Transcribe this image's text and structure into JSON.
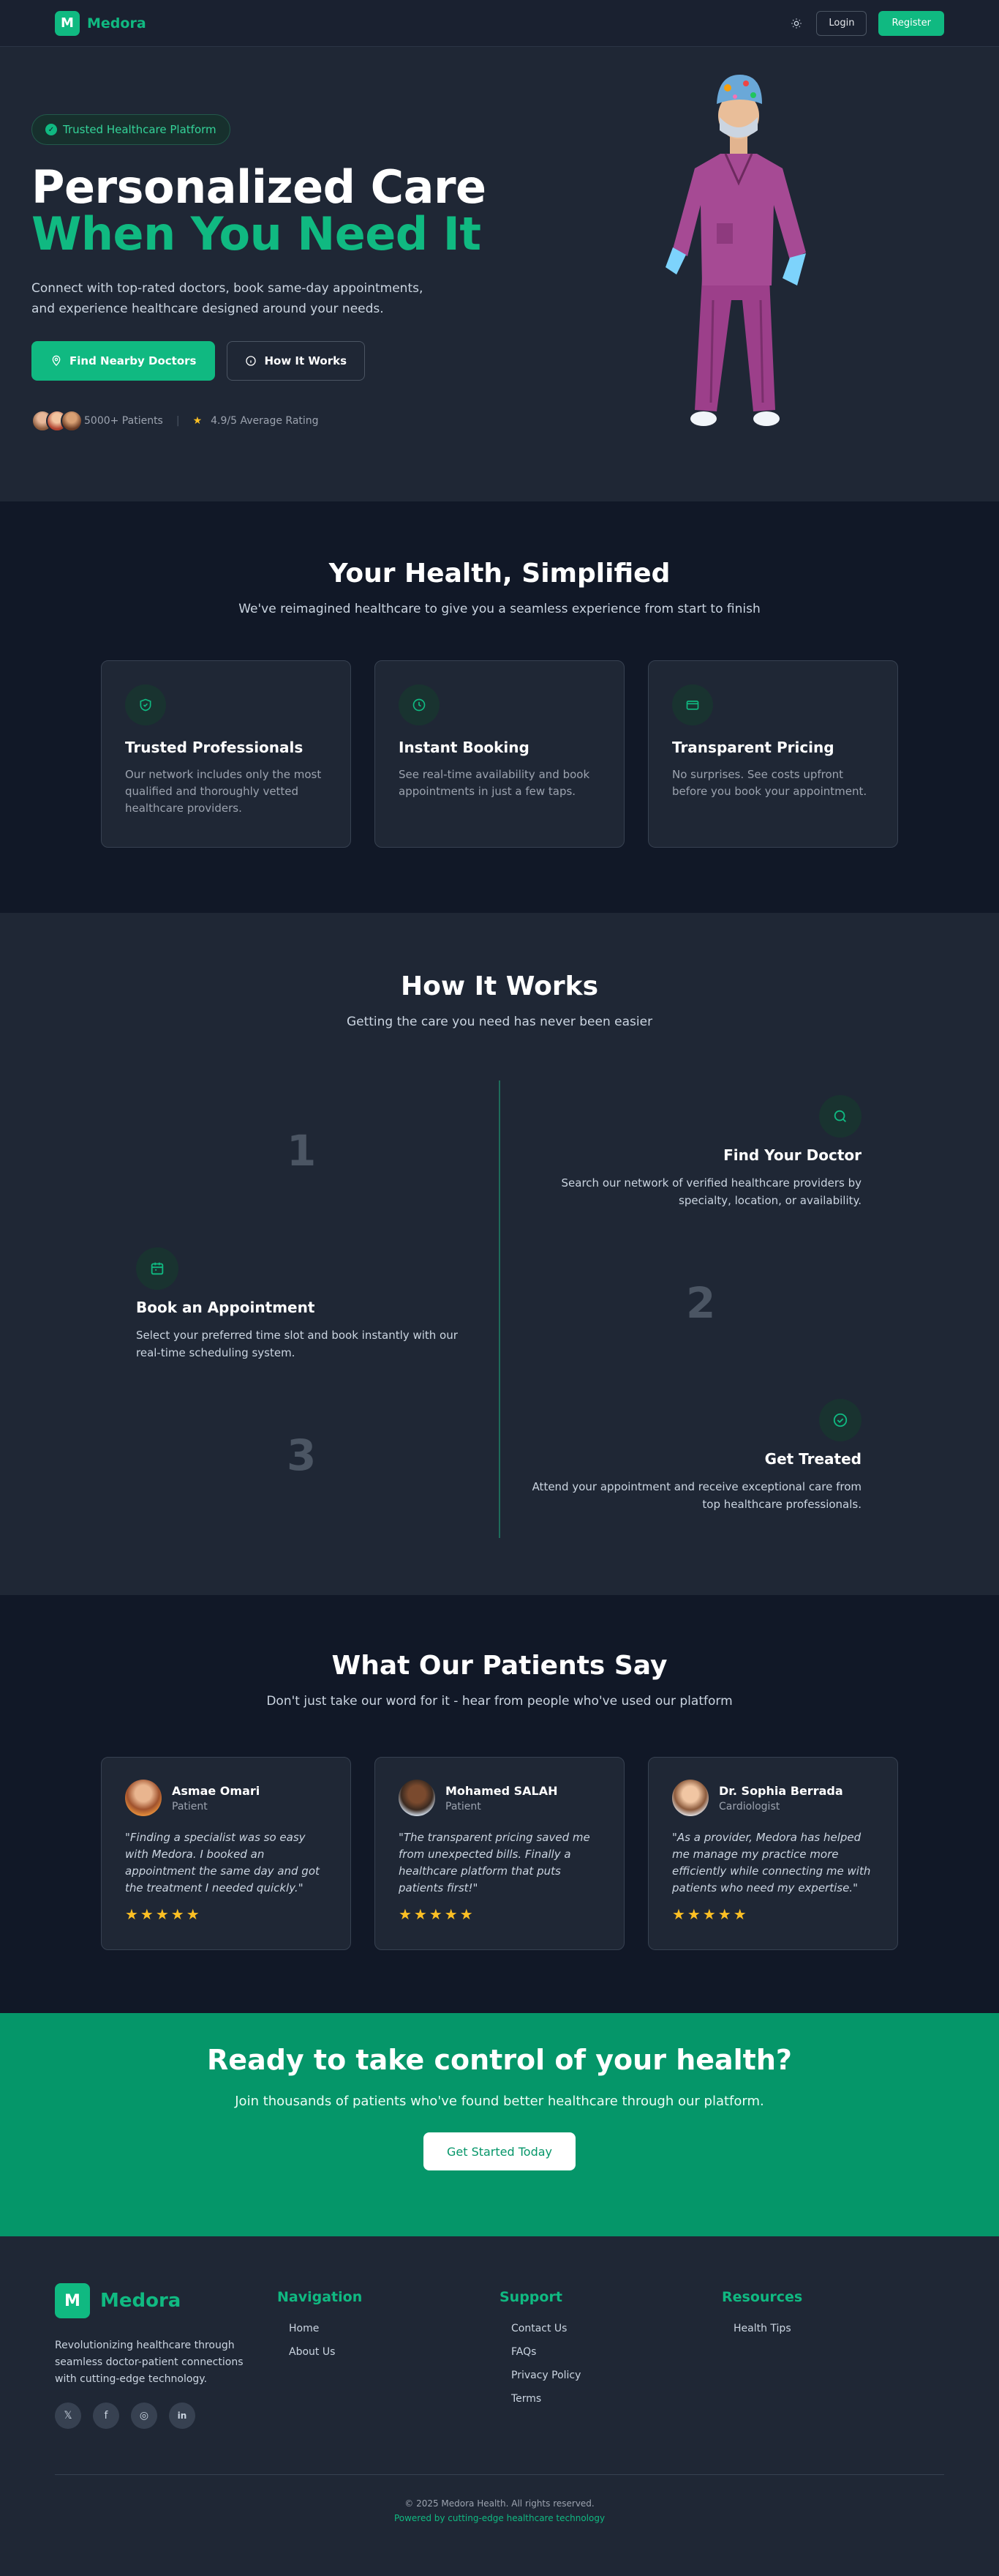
{
  "nav": {
    "logo_letter": "M",
    "brand": "Medora",
    "theme_icon": "sun-icon",
    "login": "Login",
    "register": "Register"
  },
  "hero": {
    "badge": "Trusted Healthcare Platform",
    "title_line1": "Personalized Care",
    "title_line2": "When You Need It",
    "subtitle": "Connect with top-rated doctors, book same-day appointments, and experience healthcare designed around your needs.",
    "primary_btn": "Find Nearby Doctors",
    "secondary_btn": "How It Works",
    "patients": "5000+ Patients",
    "rating": "4.9/5 Average Rating"
  },
  "features": {
    "title": "Your Health, Simplified",
    "subtitle": "We've reimagined healthcare to give you a seamless experience from start to finish",
    "cards": [
      {
        "icon": "shield-check-icon",
        "title": "Trusted Professionals",
        "text": "Our network includes only the most qualified and thoroughly vetted healthcare providers."
      },
      {
        "icon": "clock-icon",
        "title": "Instant Booking",
        "text": "See real-time availability and book appointments in just a few taps."
      },
      {
        "icon": "credit-card-icon",
        "title": "Transparent Pricing",
        "text": "No surprises. See costs upfront before you book your appointment."
      }
    ]
  },
  "how": {
    "title": "How It Works",
    "subtitle": "Getting the care you need has never been easier",
    "steps": [
      {
        "num": "1",
        "icon": "search-icon",
        "title": "Find Your Doctor",
        "text": "Search our network of verified healthcare providers by specialty, location, or availability."
      },
      {
        "num": "2",
        "icon": "calendar-icon",
        "title": "Book an Appointment",
        "text": "Select your preferred time slot and book instantly with our real-time scheduling system."
      },
      {
        "num": "3",
        "icon": "check-circle-icon",
        "title": "Get Treated",
        "text": "Attend your appointment and receive exceptional care from top healthcare professionals."
      }
    ]
  },
  "testimonials": {
    "title": "What Our Patients Say",
    "subtitle": "Don't just take our word for it - hear from people who've used our platform",
    "items": [
      {
        "name": "Asmae Omari",
        "role": "Patient",
        "quote": "\"Finding a specialist was so easy with Medora. I booked an appointment the same day and got the treatment I needed quickly.\"",
        "stars": "★★★★★"
      },
      {
        "name": "Mohamed SALAH",
        "role": "Patient",
        "quote": "\"The transparent pricing saved me from unexpected bills. Finally a healthcare platform that puts patients first!\"",
        "stars": "★★★★★"
      },
      {
        "name": "Dr. Sophia Berrada",
        "role": "Cardiologist",
        "quote": "\"As a provider, Medora has helped me manage my practice more efficiently while connecting me with patients who need my expertise.\"",
        "stars": "★★★★★"
      }
    ]
  },
  "cta": {
    "title": "Ready to take control of your health?",
    "subtitle": "Join thousands of patients who've found better healthcare through our platform.",
    "button": "Get Started Today"
  },
  "footer": {
    "logo_letter": "M",
    "brand": "Medora",
    "description": "Revolutionizing healthcare through seamless doctor-patient connections with cutting-edge technology.",
    "socials": [
      {
        "icon": "x-twitter-icon",
        "glyph": "𝕏"
      },
      {
        "icon": "facebook-icon",
        "glyph": "f"
      },
      {
        "icon": "instagram-icon",
        "glyph": "◎"
      },
      {
        "icon": "linkedin-icon",
        "glyph": "in"
      }
    ],
    "columns": [
      {
        "heading": "Navigation",
        "links": [
          "Home",
          "About Us"
        ]
      },
      {
        "heading": "Support",
        "links": [
          "Contact Us",
          "FAQs",
          "Privacy Policy",
          "Terms"
        ]
      },
      {
        "heading": "Resources",
        "links": [
          "Health Tips"
        ]
      }
    ],
    "copyright": "© 2025 Medora Health. All rights reserved.",
    "powered": "Powered by cutting-edge healthcare technology"
  }
}
